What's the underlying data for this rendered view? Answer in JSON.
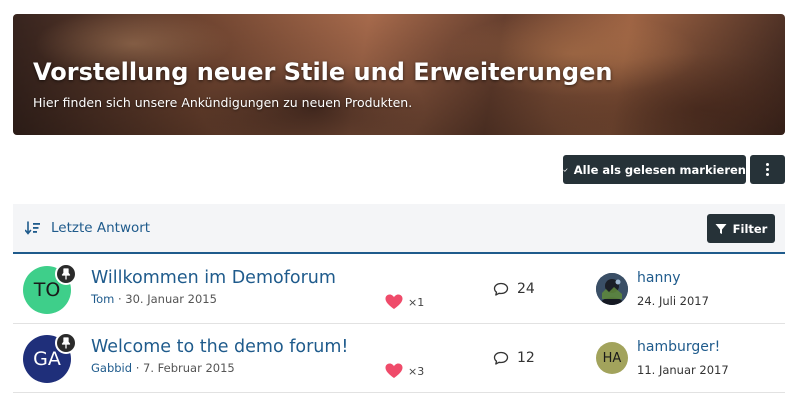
{
  "colors": {
    "accent": "#1f5b8c",
    "dark_button": "#263238",
    "heart": "#ef4b6a",
    "header_bg": "#f4f5f7"
  },
  "hero": {
    "title": "Vorstellung neuer Stile und Erweiterungen",
    "subtitle": "Hier finden sich unsere Ankündigungen zu neuen Produkten."
  },
  "actions": {
    "mark_all_read": "Alle als gelesen markieren",
    "more_icon": "vertical-ellipsis-icon"
  },
  "list_header": {
    "sort_label": "Letzte Antwort",
    "sort_icon": "sort-descending-icon",
    "filter_label": "Filter",
    "filter_icon": "funnel-icon"
  },
  "threads": [
    {
      "avatar_initials": "TO",
      "avatar_color": "#3ecf8a",
      "pinned": true,
      "title": "Willkommen im Demoforum",
      "author": "Tom",
      "separator": "·",
      "date": "30. Januar 2015",
      "likes": "×1",
      "replies": "24",
      "last_user": "hanny",
      "last_avatar_initials": "",
      "last_avatar_type": "photo",
      "last_date": "24. Juli 2017"
    },
    {
      "avatar_initials": "GA",
      "avatar_color": "#1f2f7a",
      "pinned": true,
      "title": "Welcome to the demo forum!",
      "author": "Gabbid",
      "separator": "·",
      "date": "7. Februar 2015",
      "likes": "×3",
      "replies": "12",
      "last_user": "hamburger!",
      "last_avatar_initials": "HA",
      "last_avatar_color": "#a2a35c",
      "last_date": "11. Januar 2017"
    }
  ]
}
